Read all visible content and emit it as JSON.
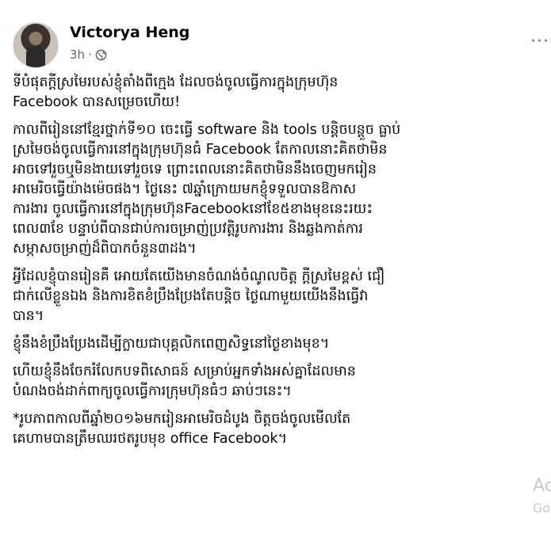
{
  "post": {
    "author": "Victorya Heng",
    "time": "3h",
    "separator": "·",
    "privacy_icon": "globe-icon",
    "more_icon": "ellipsis-icon",
    "more_label": "···",
    "paragraphs": [
      [
        "ទីបំផុតក្តីស្រមៃរបស់ខ្ញុំតាំងពីក្មេង ដែលចង់ចូលធ្វើការក្នុងក្រុមហ៊ុន",
        "Facebook បានសម្រេចហើយ!"
      ],
      [
        "កាលពីរៀននៅខ្មែរថ្នាក់ទី១០ ចេះធ្វើ software និង tools បន្តិចបន្តួច ធ្លាប់",
        "ស្រមៃចង់ចូលធ្វើការនៅក្នុងក្រុមហ៊ុនធំ Facebook តែកាលនោះគិតថាមិន",
        "អាចទៅរួចឬមិនងាយទៅរួចទេ ព្រោះពេលនោះគិតថាមិននឹងចេញមករៀន",
        "អាមេរិចធ្វើយ៉ាងម៉េចផង។ ថ្ងៃនេះ ៧ឆ្នាំក្រោយមកខ្ញុំទទួលបានឱកាស",
        "ការងារ ចូលធ្វើការនៅក្នុងក្រុមហ៊ុនFacebookនៅខែ៥ខាងមុខនេះរយះ",
        "ពេល៣ខែ បន្ទាប់ពីបានជាប់ការចម្រាញ់ប្រវត្តិរូបការងារ និងឆ្លងកាត់ការ",
        "សម្ភាសចម្រាញ់ដ៏ពិបាកចំនួន៣ដង។"
      ],
      [
        "អ្វីដែលខ្ញុំបានរៀនគឺ អោយតែយើងមានចំណង់ចំណូលចិត្ត ក្តីស្រមៃខ្ពស់ ជឿ",
        "ជាក់លើខ្លួនឯង និងការខិតខំប្រឹងប្រែងតែបន្តិច ថ្ងៃណាមួយយើងនឹងធ្វើវា",
        "បាន។"
      ],
      [
        "ខ្ញុំនឹងខំប្រឹងប្រែងដើម្បីក្លាយជាបុគ្គលិកពេញសិទ្ធនៅថ្ងៃខាងមុខ។"
      ],
      [
        "ហើយខ្ញុំនឹងចែករំលែកបទពិសោធន៍ សម្រាប់អ្នកទាំងអស់គ្នាដែលមាន",
        "បំណងចង់ដាក់ពាក្យចូលធ្វើការក្រុមហ៊ុនធំៗ ឆាប់ៗនេះ។"
      ],
      [
        "*រូបភាពកាលពីឆ្នាំ២០១៦មករៀនអាមេរិចដំបូង ចិត្តចង់ចូលមើលតែ",
        "គេហាមបានត្រឹមឈរថតរូបមុខ office Facebook។"
      ]
    ]
  },
  "watermark": {
    "line1": "Ac",
    "line2": "Go"
  }
}
